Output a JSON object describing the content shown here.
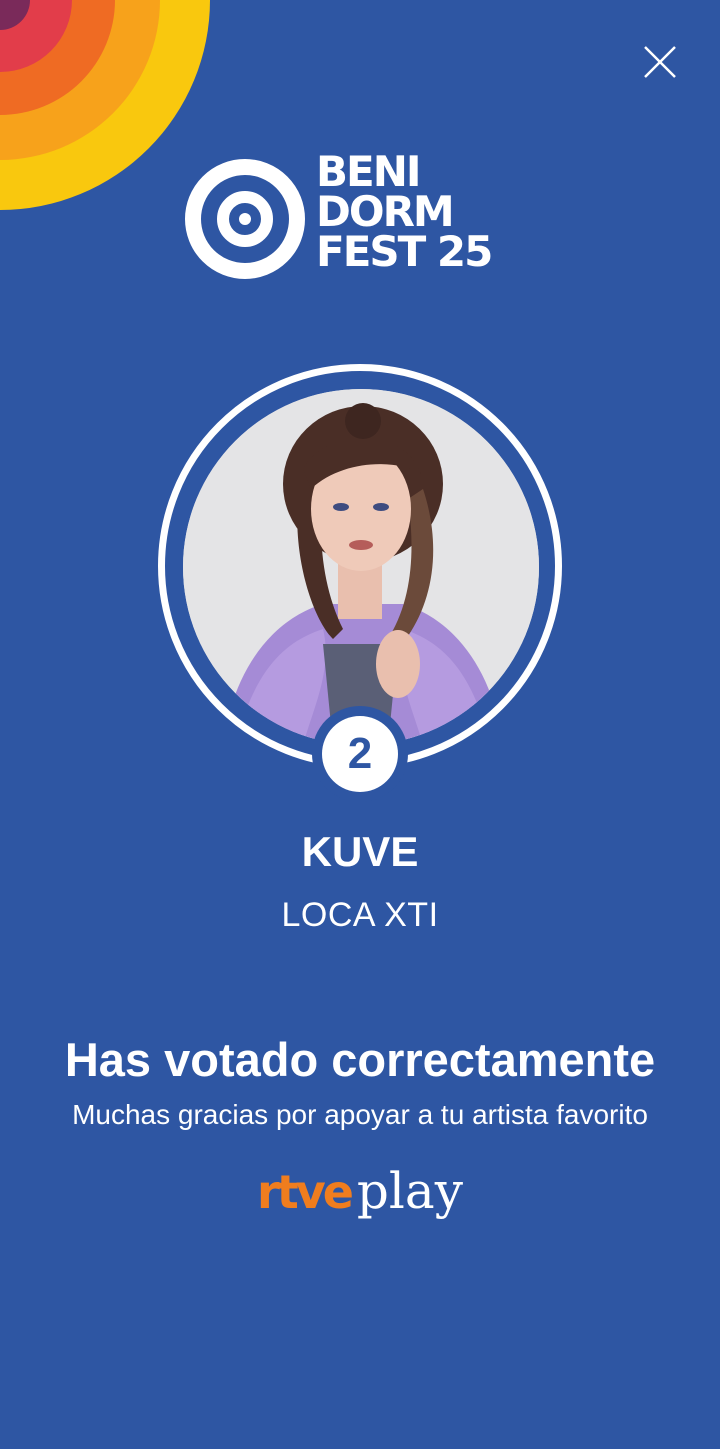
{
  "colors": {
    "background": "#2e56a3",
    "text": "#ffffff",
    "brand_accent": "#f07d1e"
  },
  "header": {
    "close_icon": "close-icon"
  },
  "logo": {
    "line1": "BENI",
    "line2": "DORM",
    "line3": "FEST 25",
    "icon": "target-icon"
  },
  "candidate": {
    "rank": "2",
    "artist": "KUVE",
    "song": "LOCA XTI"
  },
  "confirmation": {
    "title": "Has votado correctamente",
    "subtitle": "Muchas gracias por apoyar a tu artista favorito"
  },
  "brand": {
    "rtve": "rtve",
    "play": "play"
  }
}
